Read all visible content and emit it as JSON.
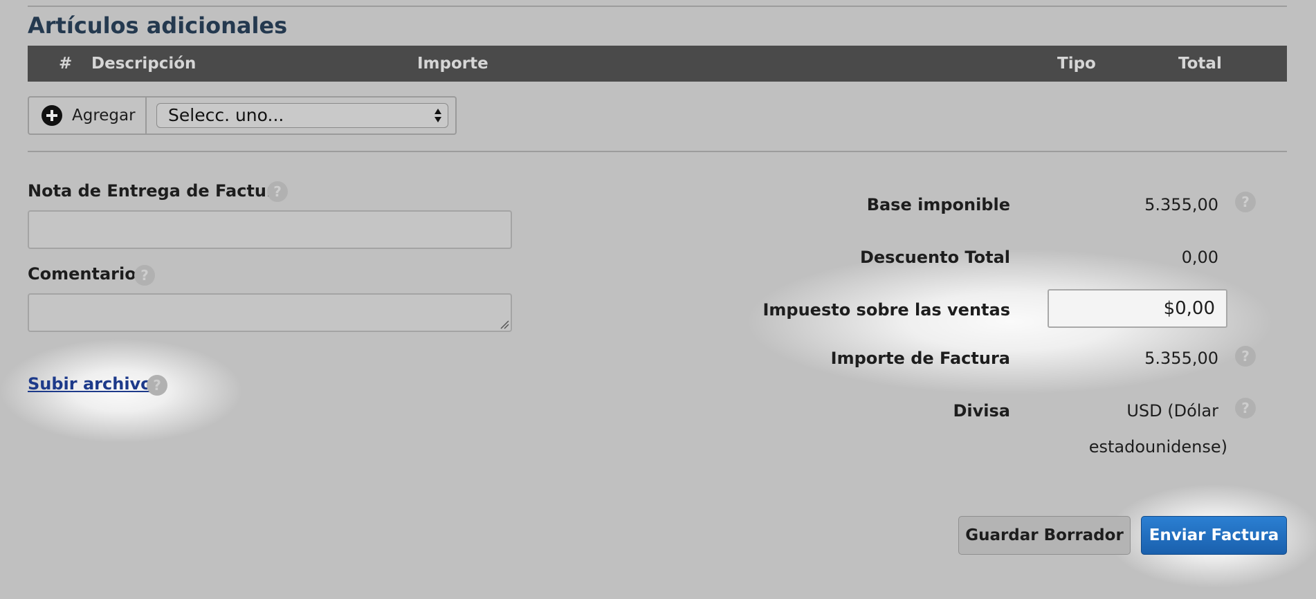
{
  "section": {
    "title": "Artículos adicionales"
  },
  "table": {
    "columns": {
      "index": "#",
      "description": "Descripción",
      "amount": "Importe",
      "type": "Tipo",
      "total": "Total"
    }
  },
  "add_row": {
    "add_label": "Agregar",
    "select_value": "Selecc. uno..."
  },
  "fields": {
    "delivery_note_label": "Nota de Entrega de Factura",
    "comment_label": "Comentario",
    "help_glyph": "?"
  },
  "upload": {
    "label": "Subir archivo"
  },
  "summary": {
    "base_label": "Base imponible",
    "base_value": "5.355,00",
    "discount_label": "Descuento Total",
    "discount_value": "0,00",
    "tax_label": "Impuesto sobre las ventas",
    "tax_value": "$0,00",
    "invoice_amount_label": "Importe de Factura",
    "invoice_amount_value": "5.355,00",
    "currency_label": "Divisa",
    "currency_value_line1": "USD (Dólar",
    "currency_value_line2": "estadounidense)"
  },
  "buttons": {
    "save_draft": "Guardar Borrador",
    "send_invoice": "Enviar Factura"
  },
  "colors": {
    "background": "#c0c0c0",
    "table_header": "#4a4a4a",
    "title": "#24394f",
    "link": "#1d3a8a",
    "primary_button": "#1a60ad"
  },
  "icons": {
    "add": "plus-circle-icon",
    "help": "question-circle-icon",
    "select": "select-arrows-icon"
  }
}
